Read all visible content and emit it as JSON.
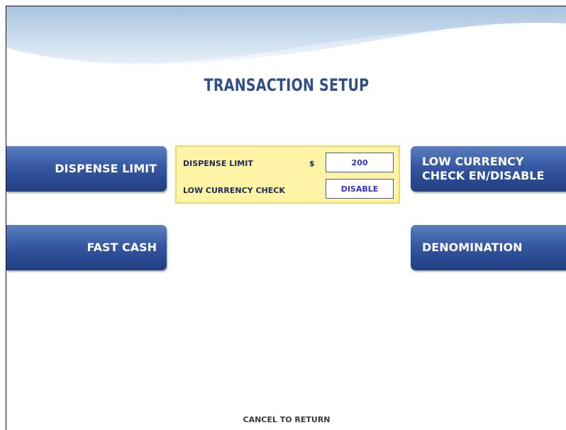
{
  "screen": {
    "title": "TRANSACTION SETUP",
    "footer": "CANCEL TO RETURN"
  },
  "buttons": {
    "left": [
      {
        "label": "DISPENSE LIMIT"
      },
      {
        "label": "FAST CASH"
      }
    ],
    "right": [
      {
        "line1": "LOW CURRENCY",
        "line2": "CHECK EN/DISABLE"
      },
      {
        "label": "DENOMINATION"
      }
    ]
  },
  "info_panel": {
    "dispense_limit_label": "DISPENSE LIMIT",
    "currency_symbol": "$",
    "dispense_limit_value": "200",
    "low_currency_label": "LOW CURRENCY CHECK",
    "low_currency_value": "DISABLE"
  },
  "colors": {
    "button_blue": "#2b4a93",
    "title_blue": "#2f4f86",
    "panel_yellow": "#fff4a5",
    "value_text": "#3333cc"
  }
}
